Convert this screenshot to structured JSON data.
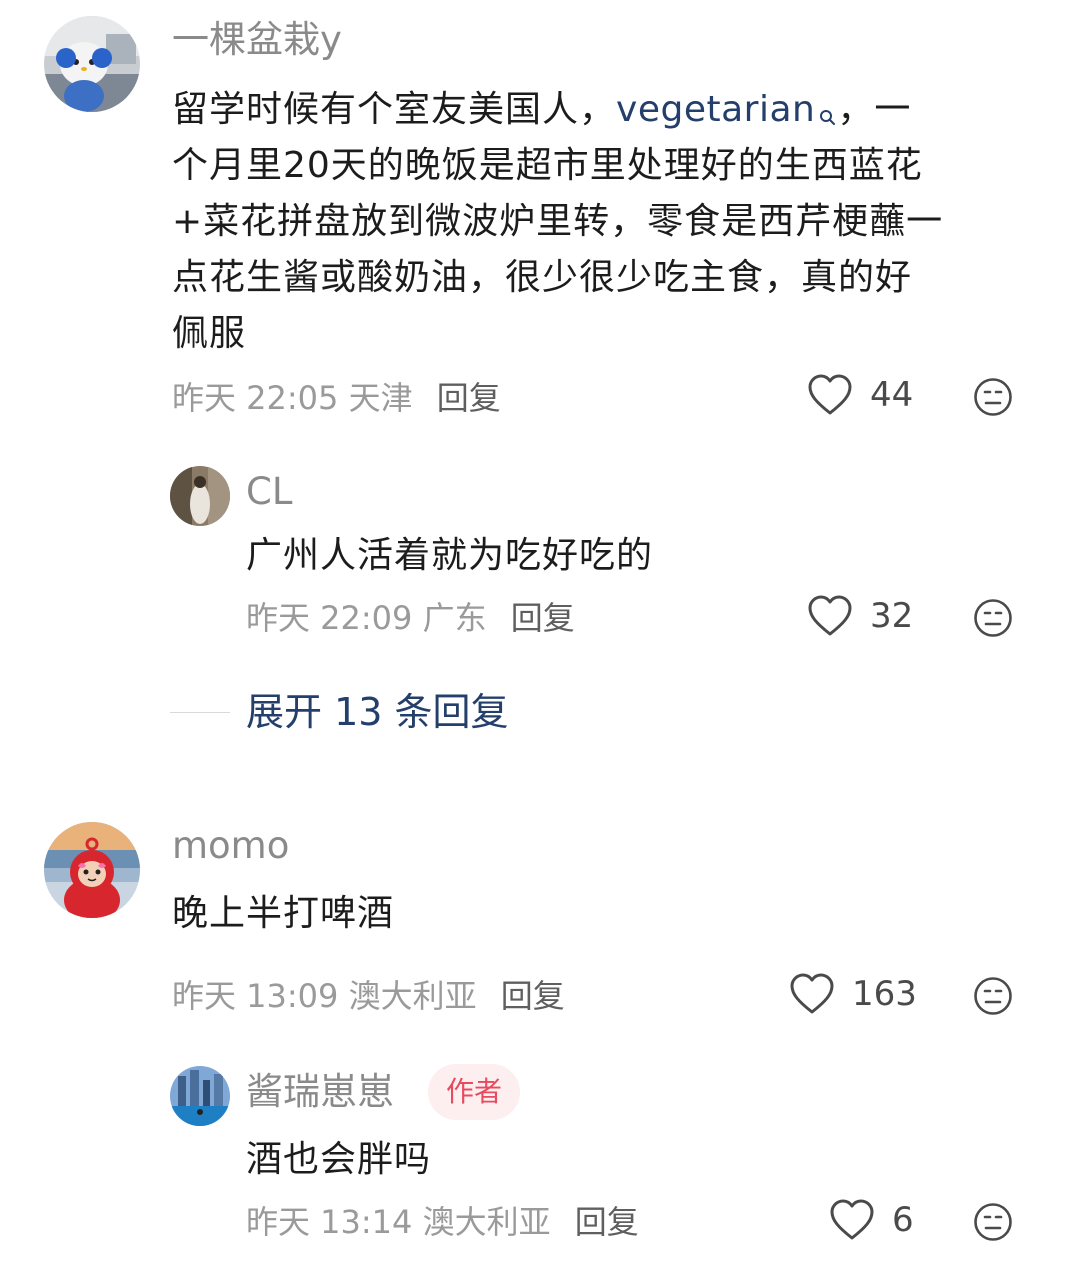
{
  "comments": [
    {
      "user": "一棵盆栽y",
      "text_before": "留学时候有个室友美国人，",
      "link_word": "vegetarian",
      "text_after_link": "，一",
      "lines": [
        "个月里20天的晚饭是超市里处理好的生西蓝花",
        "+菜花拼盘放到微波炉里转，零食是西芹梗蘸一",
        "点花生酱或酸奶油，很少很少吃主食，真的好",
        "佩服"
      ],
      "time": "昨天 22:05",
      "location": "天津",
      "reply_label": "回复",
      "likes": "44",
      "replies": [
        {
          "user": "CL",
          "text": "广州人活着就为吃好吃的",
          "time": "昨天 22:09",
          "location": "广东",
          "reply_label": "回复",
          "likes": "32"
        }
      ],
      "expand_label": "展开 13 条回复"
    },
    {
      "user": "momo",
      "text": "晚上半打啤酒",
      "time": "昨天 13:09",
      "location": "澳大利亚",
      "reply_label": "回复",
      "likes": "163",
      "replies": [
        {
          "user": "酱瑞崽崽",
          "badge": "作者",
          "text": "酒也会胖吗",
          "time": "昨天 13:14",
          "location": "澳大利亚",
          "reply_label": "回复",
          "likes": "6"
        }
      ]
    }
  ],
  "icons": {
    "like": "heart-outline-icon",
    "dislike": "meh-face-icon",
    "search_hint": "search-mini-icon"
  },
  "colors": {
    "link": "#243f6b",
    "badge_bg": "#fdeef0",
    "badge_text": "#e84a5f",
    "meta": "#9a9a9a"
  }
}
